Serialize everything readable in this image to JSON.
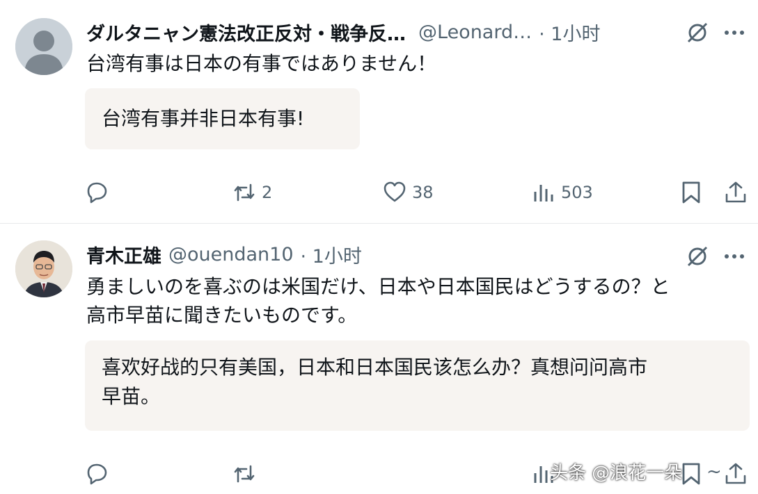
{
  "posts": [
    {
      "name": "ダルタニャン憲法改正反対・戦争反…",
      "handle": "@Leonard…",
      "time": "· 1小时",
      "text": "台湾有事は日本の有事ではありません！",
      "translation": "台湾有事并非日本有事!",
      "reply_count": "",
      "repost_count": "2",
      "like_count": "38",
      "view_count": "503"
    },
    {
      "name": "青木正雄",
      "handle": "@ouendan10",
      "time": "· 1小时",
      "text_line1": "勇ましいのを喜ぶのは米国だけ、日本や日本国民はどうするの？と",
      "text_line2": "高市早苗に聞きたいものです。",
      "translation_line1": "喜欢好战的只有美国，日本和日本国民该怎么办？真想问问高市",
      "translation_line2": "早苗。"
    }
  ],
  "watermark": "头条 @浪花一朵",
  "watermark_tail": "~",
  "icons": {
    "reply": "reply-icon",
    "repost": "repost-icon",
    "like": "like-icon",
    "views": "views-icon",
    "bookmark": "bookmark-icon",
    "share": "share-icon",
    "grok": "grok-icon",
    "more": "more-icon"
  },
  "colors": {
    "text": "#0f1419",
    "secondary": "#536471",
    "translation_bg": "#f7f4f1",
    "divider": "#e7e9ea"
  }
}
